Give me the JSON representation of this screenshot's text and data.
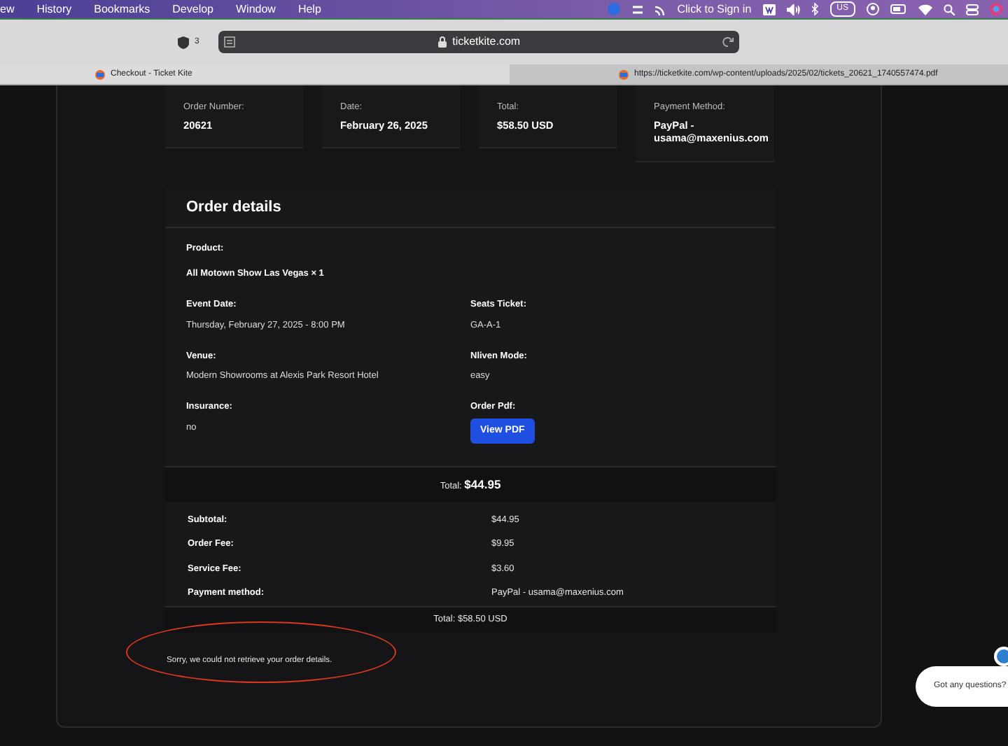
{
  "menu_bar": {
    "items": [
      "ew",
      "History",
      "Bookmarks",
      "Develop",
      "Window",
      "Help"
    ],
    "sign_in": "Click to Sign in",
    "input_source": "US"
  },
  "toolbar": {
    "shield_count": "3",
    "address": "ticketkite.com"
  },
  "tabs": [
    {
      "title": "Checkout - Ticket Kite",
      "selected": true
    },
    {
      "title": "https://ticketkite.com/wp-content/uploads/2025/02/tickets_20621_1740557474.pdf",
      "selected": false
    }
  ],
  "summary": [
    {
      "label": "Order Number:",
      "value": "20621"
    },
    {
      "label": "Date:",
      "value": "February 26, 2025"
    },
    {
      "label": "Total:",
      "value": "$58.50 USD"
    },
    {
      "label": "Payment Method:",
      "value": "PayPal - usama@maxenius.com"
    }
  ],
  "order_details": {
    "title": "Order details",
    "product": {
      "label": "Product:",
      "value": "All Motown Show Las Vegas × 1"
    },
    "fields": [
      {
        "label": "Event Date:",
        "value": "Thursday, February 27, 2025 - 8:00 PM",
        "kind": "text"
      },
      {
        "label": "Seats Ticket:",
        "value": "GA-A-1",
        "kind": "text"
      },
      {
        "label": "Venue:",
        "value": "Modern Showrooms at Alexis Park Resort Hotel",
        "kind": "text"
      },
      {
        "label": "Nliven Mode:",
        "value": "easy",
        "kind": "text"
      },
      {
        "label": "Insurance:",
        "value": "no",
        "kind": "text"
      },
      {
        "label": "Order Pdf:",
        "value": "View PDF",
        "kind": "button"
      }
    ],
    "subtotal": {
      "label": "Total:",
      "amount": "$44.95"
    },
    "lines": [
      {
        "label": "Subtotal:",
        "value": "$44.95"
      },
      {
        "label": "Order Fee:",
        "value": "$9.95"
      },
      {
        "label": "Service Fee:",
        "value": "$3.60"
      },
      {
        "label": "Payment method:",
        "value": "PayPal - usama@maxenius.com"
      }
    ],
    "grand_total": {
      "label": "Total:",
      "amount": "$58.50 USD"
    }
  },
  "message": "Sorry, we could not retrieve your order details.",
  "chat": {
    "text": "Got any questions?"
  }
}
